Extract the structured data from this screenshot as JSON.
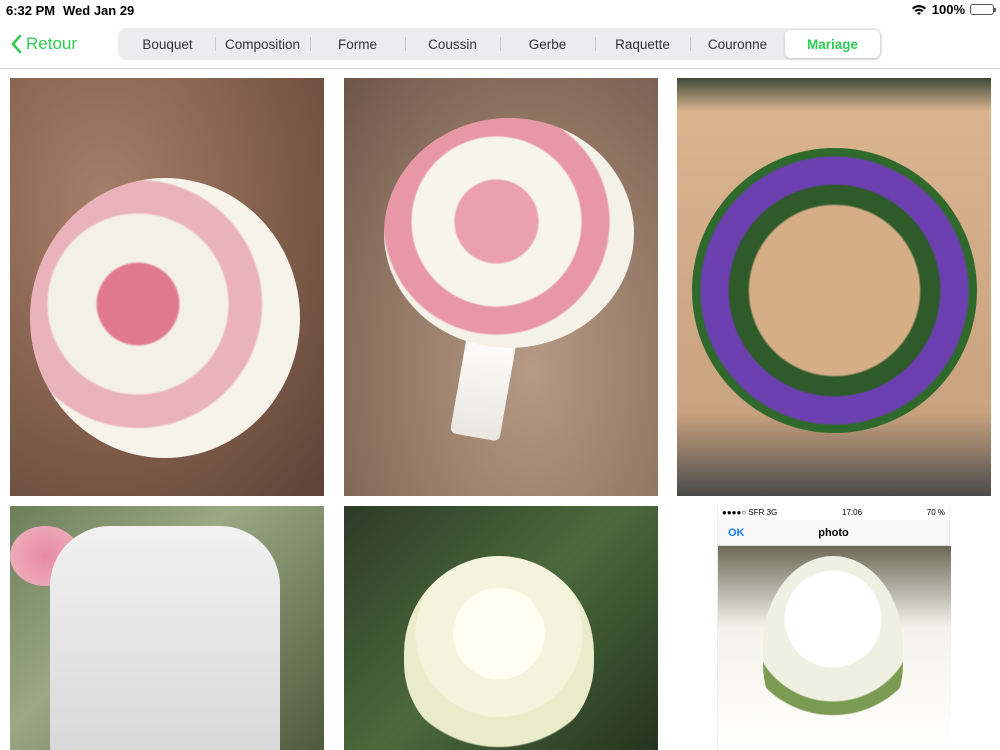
{
  "status_bar": {
    "time": "6:32 PM",
    "date": "Wed Jan 29",
    "battery_percent": "100%",
    "icons": [
      "wifi-icon",
      "battery-icon"
    ]
  },
  "nav": {
    "back_label": "Retour",
    "accent_color": "#2ecc52",
    "segments": [
      {
        "label": "Bouquet",
        "selected": false
      },
      {
        "label": "Composition",
        "selected": false
      },
      {
        "label": "Forme",
        "selected": false
      },
      {
        "label": "Coussin",
        "selected": false
      },
      {
        "label": "Gerbe",
        "selected": false
      },
      {
        "label": "Raquette",
        "selected": false
      },
      {
        "label": "Couronne",
        "selected": false
      },
      {
        "label": "Mariage",
        "selected": true
      }
    ]
  },
  "gallery": {
    "photos": [
      {
        "subject": "round-pink-white-bouquet"
      },
      {
        "subject": "pink-rose-bridal-bouquet"
      },
      {
        "subject": "purple-orchid-wreath"
      },
      {
        "subject": "white-lantern-with-roses"
      },
      {
        "subject": "white-cascade-bouquet"
      },
      {
        "subject": "phone-screenshot-bridal-bouquet"
      }
    ],
    "phone_screenshot": {
      "carrier": "●●●●○ SFR  3G",
      "time": "17:06",
      "battery": "70 %",
      "ok_label": "OK",
      "title": "photo"
    }
  }
}
